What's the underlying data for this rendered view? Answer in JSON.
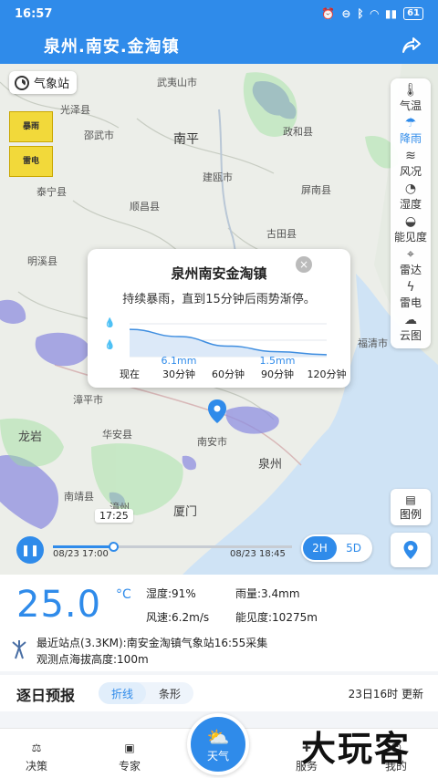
{
  "status": {
    "time": "16:57",
    "battery": "61"
  },
  "header": {
    "title": "泉州.南安.金淘镇"
  },
  "map": {
    "station_label": "气象站",
    "warnings": [
      {
        "label": "暴雨"
      },
      {
        "label": "雷电"
      }
    ],
    "cities": [
      {
        "name": "武夷山市",
        "size": "small"
      },
      {
        "name": "光泽县",
        "size": "small"
      },
      {
        "name": "邵武市",
        "size": "small"
      },
      {
        "name": "南平",
        "size": "big"
      },
      {
        "name": "政和县",
        "size": "small"
      },
      {
        "name": "泰宁县",
        "size": "small"
      },
      {
        "name": "建瓯市",
        "size": "small"
      },
      {
        "name": "顺昌县",
        "size": "small"
      },
      {
        "name": "屏南县",
        "size": "small"
      },
      {
        "name": "古田县",
        "size": "small"
      },
      {
        "name": "明溪县",
        "size": "small"
      },
      {
        "name": "福清市",
        "size": "small"
      },
      {
        "name": "漳平市",
        "size": "small"
      },
      {
        "name": "龙岩",
        "size": "mid"
      },
      {
        "name": "华安县",
        "size": "small"
      },
      {
        "name": "南安市",
        "size": "small"
      },
      {
        "name": "泉州",
        "size": "mid"
      },
      {
        "name": "南靖县",
        "size": "small"
      },
      {
        "name": "漳州",
        "size": "small"
      },
      {
        "name": "厦门",
        "size": "mid"
      }
    ]
  },
  "layers": [
    {
      "label": "气温",
      "icon": "thermometer-icon",
      "glyph": "🌡",
      "active": false
    },
    {
      "label": "降雨",
      "icon": "rain-icon",
      "glyph": "☂",
      "active": true
    },
    {
      "label": "风况",
      "icon": "wind-icon",
      "glyph": "≋",
      "active": false
    },
    {
      "label": "湿度",
      "icon": "humidity-icon",
      "glyph": "◔",
      "active": false
    },
    {
      "label": "能见度",
      "icon": "visibility-icon",
      "glyph": "◒",
      "active": false
    },
    {
      "label": "雷达",
      "icon": "radar-icon",
      "glyph": "⌖",
      "active": false
    },
    {
      "label": "雷电",
      "icon": "lightning-icon",
      "glyph": "ϟ",
      "active": false
    },
    {
      "label": "云图",
      "icon": "cloud-icon",
      "glyph": "☁",
      "active": false
    }
  ],
  "legend_label": "图例",
  "popup": {
    "title": "泉州南安金淘镇",
    "description": "持续暴雨，直到15分钟后雨势渐停。",
    "value_labels": [
      "6.1mm",
      "1.5mm"
    ],
    "ticks": [
      "现在",
      "30分钟",
      "60分钟",
      "90分钟",
      "120分钟"
    ]
  },
  "chart_data": {
    "type": "area",
    "title": "泉州南安金淘镇",
    "x": [
      "现在",
      "30分钟",
      "60分钟",
      "90分钟",
      "120分钟"
    ],
    "series": [
      {
        "values": [
          8.3,
          6.1,
          3.2,
          1.5,
          0.6
        ]
      }
    ],
    "annotations": [
      "6.1mm",
      "1.5mm"
    ]
  },
  "timeline": {
    "tip": "17:25",
    "start": "08/23 17:00",
    "end": "08/23 18:45",
    "progress": 0.25,
    "ranges": [
      "2H",
      "5D"
    ]
  },
  "live": {
    "temperature": "25.0",
    "unit": "°C",
    "humidity": "湿度:91%",
    "rainfall": "雨量:3.4mm",
    "wind": "风速:6.2m/s",
    "visibility": "能见度:10275m",
    "nearby": "最近站点(3.3KM):南安金淘镇气象站16:55采集",
    "altitude": "观测点海拔高度:100m"
  },
  "forecast": {
    "title": "逐日预报",
    "tabs": [
      "折线",
      "条形"
    ],
    "update": "23日16时 更新"
  },
  "nav": {
    "items": [
      "决策",
      "专家",
      "天气",
      "服务",
      "我的"
    ]
  },
  "watermark": "大玩客",
  "colors": {
    "accent": "#2f8bea",
    "rain": "#8f8fe0",
    "warning": "#f2d93a"
  }
}
